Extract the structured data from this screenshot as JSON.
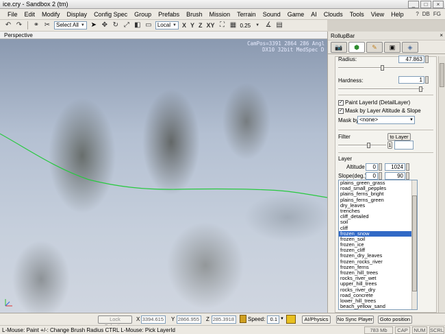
{
  "window": {
    "title": "ice.cry - Sandbox 2 (tm)"
  },
  "menu": [
    "File",
    "Edit",
    "Modify",
    "Display",
    "Config Spec",
    "Group",
    "Prefabs",
    "Brush",
    "Mission",
    "Terrain",
    "Sound",
    "Game",
    "AI",
    "Clouds",
    "Tools",
    "View",
    "Help"
  ],
  "menu_right": [
    "DB",
    "FG"
  ],
  "toolbar": {
    "select_combo": "Select All",
    "coord_combo": "Local",
    "axes": [
      "X",
      "Y",
      "Z",
      "XY"
    ],
    "grid_value": "0.25"
  },
  "viewport": {
    "label": "Perspective",
    "cam_line1": "CamPos=3391 2864 286 Angl",
    "cam_line2": "DX10 32bit MedSpec D"
  },
  "rollup": {
    "title": "RollupBar",
    "tabs": [
      "objects-tab",
      "terrain-tab",
      "modeling-tab",
      "display-tab",
      "layers-tab"
    ],
    "radius_label": "Radius:",
    "radius_value": "47.863",
    "hardness_label": "Hardness:",
    "hardness_value": "1",
    "paint_layer_label": "Paint LayerId (DetailLayer)",
    "paint_layer_checked": true,
    "mask_altitude_label": "Mask by Layer Altitude & Slope",
    "mask_altitude_checked": true,
    "mask_by_label": "Mask by",
    "mask_by_value": "<none>",
    "filter_label": "Filter",
    "to_layer_button": "to Layer",
    "filter_button": "1",
    "layer_label": "Layer",
    "altitude_label": "Altitude",
    "altitude_min": "0",
    "altitude_max": "1024",
    "slope_label": "Slope(deg.)",
    "slope_min": "0",
    "slope_max": "90",
    "layers": [
      "plains_green_grass",
      "road_small_pepples",
      "plains_ferns_bright",
      "plains_ferns_green",
      "dry_leaves",
      "trenches",
      "cliff_detailed",
      "soil",
      "cliff",
      "frozen_snow",
      "frozen_soil",
      "frozen_ice",
      "frozen_cliff",
      "frozen_dry_leaves",
      "frozen_rocks_river",
      "frozen_ferns",
      "frozen_hill_trees",
      "rocks_river_wet",
      "upper_hill_trees",
      "rocks_river_dry",
      "road_concrete",
      "lower_hill_trees",
      "beach_yellow_sand"
    ],
    "selected_layer": "frozen_snow"
  },
  "statusbar": {
    "lock_selection": "Lock Selection",
    "x_label": "X",
    "x_value": "3394.615",
    "y_label": "Y",
    "y_value": "2866.955",
    "z_label": "Z",
    "z_value": "285.3918",
    "speed_label": "Speed:",
    "speed_value": "0.1",
    "ai_physics": "AI/Physics",
    "no_sync_player": "No Sync Player",
    "goto_position": "Goto position"
  },
  "hintbar": {
    "hint": "L-Mouse: Paint   +/-: Change Brush Radius   CTRL L-Mouse: Pick LayerId",
    "memory": "783 Mb",
    "cap": "CAP",
    "num": "NUM",
    "scrl": "SCRL"
  },
  "colors": {
    "selection": "#3169c6",
    "terrain_line": "#27c93f",
    "rollup_active_tab": "#2e8b2e"
  }
}
